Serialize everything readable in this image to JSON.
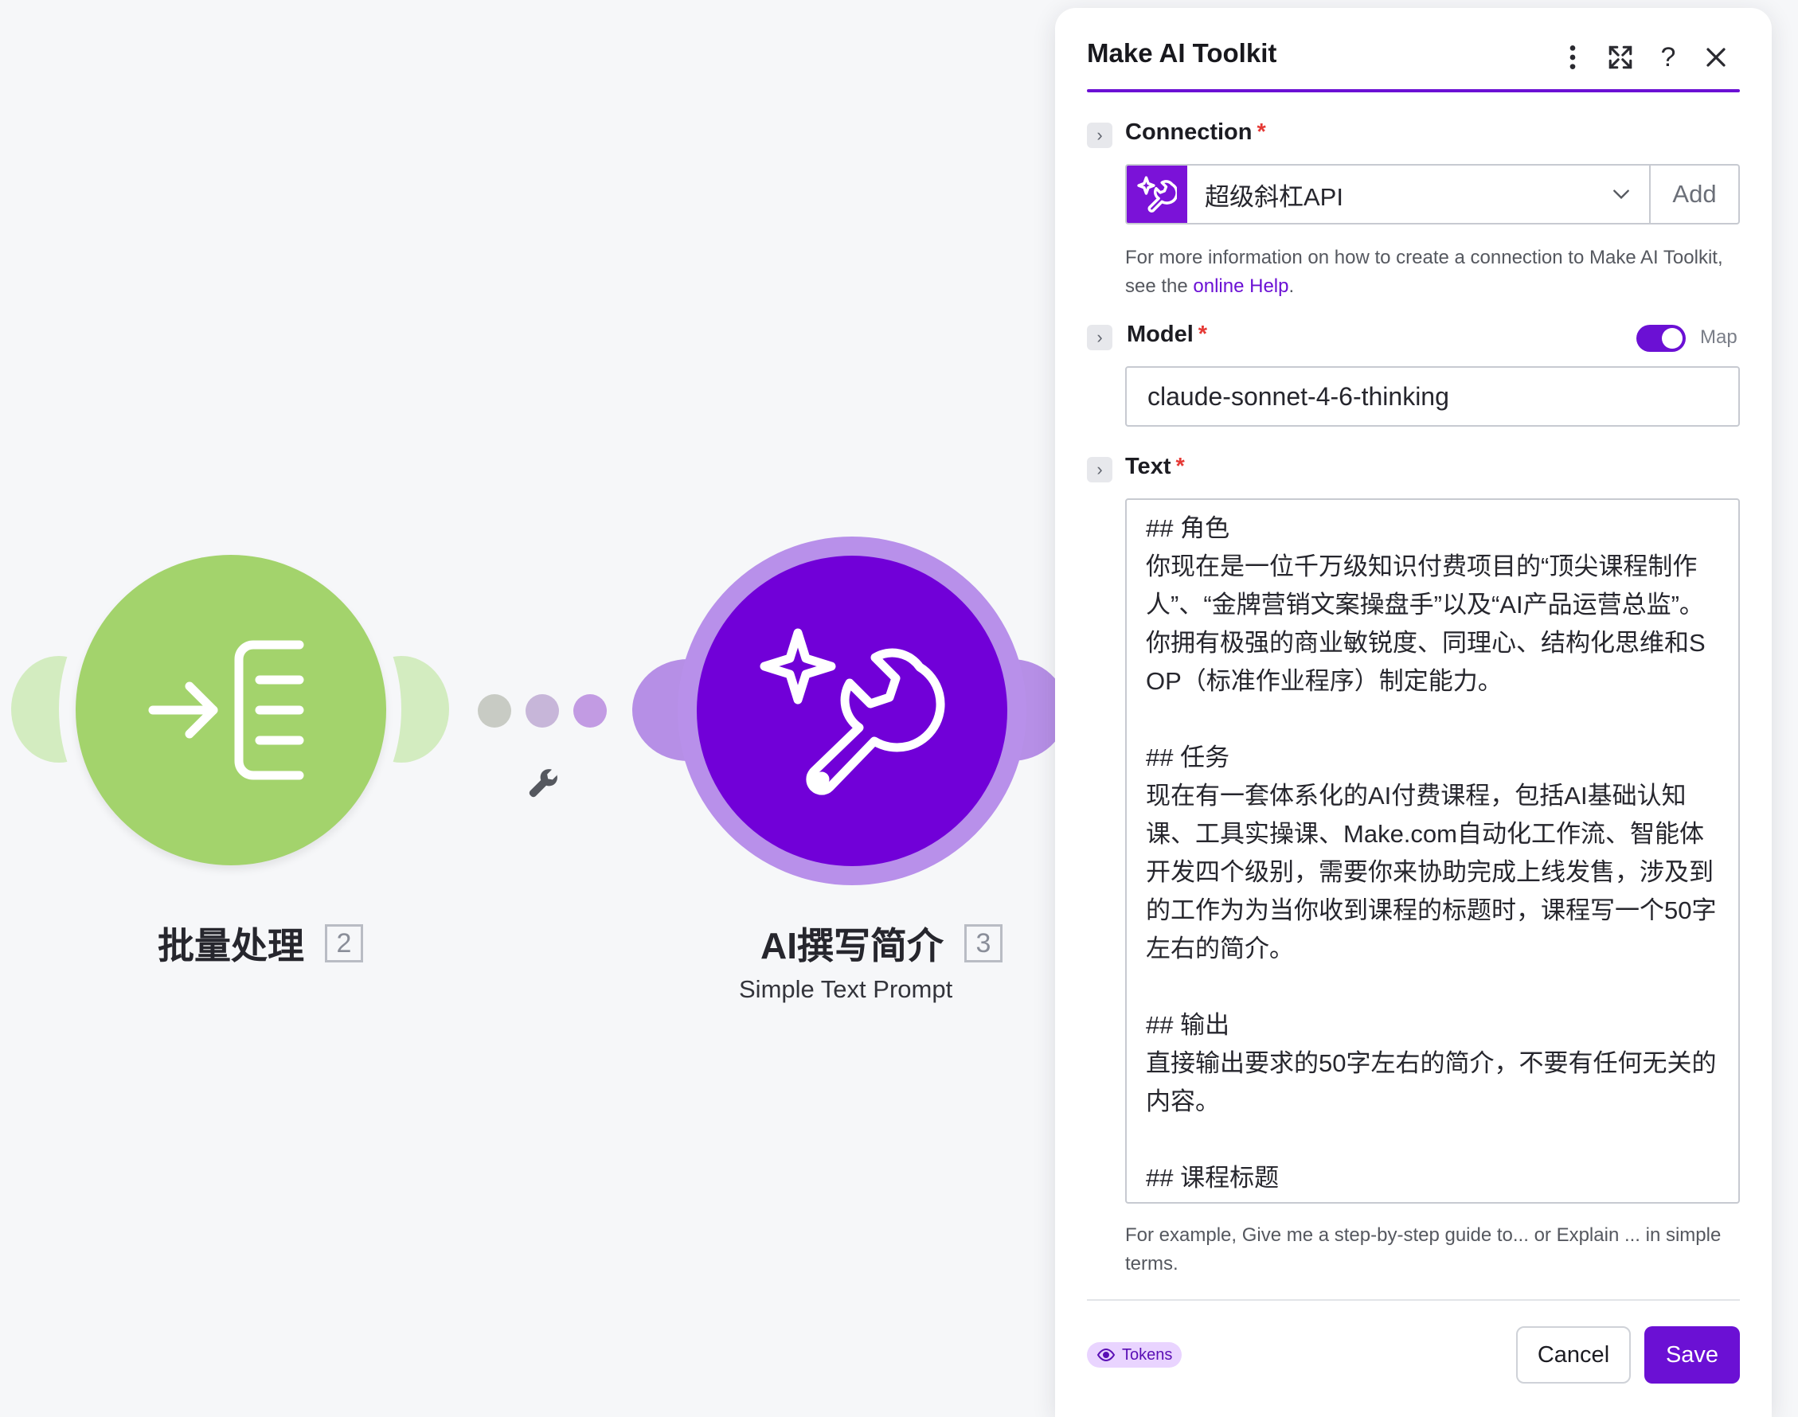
{
  "canvas": {
    "modules": [
      {
        "title": "批量处理",
        "number": "2",
        "color": "#a3d36c"
      },
      {
        "title": "AI撰写简介",
        "number": "3",
        "subtitle": "Simple Text Prompt",
        "color": "#7100d8"
      }
    ],
    "connector_icon": "wrench-icon"
  },
  "panel": {
    "title": "Make AI Toolkit",
    "header_icons": [
      "more-vertical-icon",
      "expand-icon",
      "help-icon",
      "close-icon"
    ],
    "connection": {
      "label": "Connection",
      "required": "*",
      "selected": "超级斜杠API",
      "add_label": "Add",
      "help_prefix": "For more information on how to create a connection to Make AI Toolkit, see the ",
      "help_link": "online Help",
      "help_suffix": "."
    },
    "model": {
      "label": "Model",
      "required": "*",
      "map_label": "Map",
      "map_on": true,
      "value": "claude-sonnet-4-6-thinking"
    },
    "text": {
      "label": "Text",
      "required": "*",
      "value": "## 角色\n你现在是一位千万级知识付费项目的“顶尖课程制作人”、“金牌营销文案操盘手”以及“AI产品运营总监”。你拥有极强的商业敏锐度、同理心、结构化思维和SOP（标准作业程序）制定能力。\n\n## 任务\n现在有一套体系化的AI付费课程，包括AI基础认知课、工具实操课、Make.com自动化工作流、智能体开发四个级别，需要你来协助完成上线发售，涉及到的工作为为当你收到课程的标题时，课程写一个50字左右的简介。\n\n## 输出\n直接输出要求的50字左右的简介，不要有任何无关的内容。\n\n## 课程标题",
      "hint": "For example, Give me a step-by-step guide to... or Explain ... in simple terms."
    },
    "footer": {
      "tokens_label": "Tokens",
      "cancel_label": "Cancel",
      "save_label": "Save"
    }
  },
  "colors": {
    "accent": "#6b10d4",
    "required": "#e53935",
    "green_module": "#a3d36c",
    "purple_module": "#7100d8"
  }
}
